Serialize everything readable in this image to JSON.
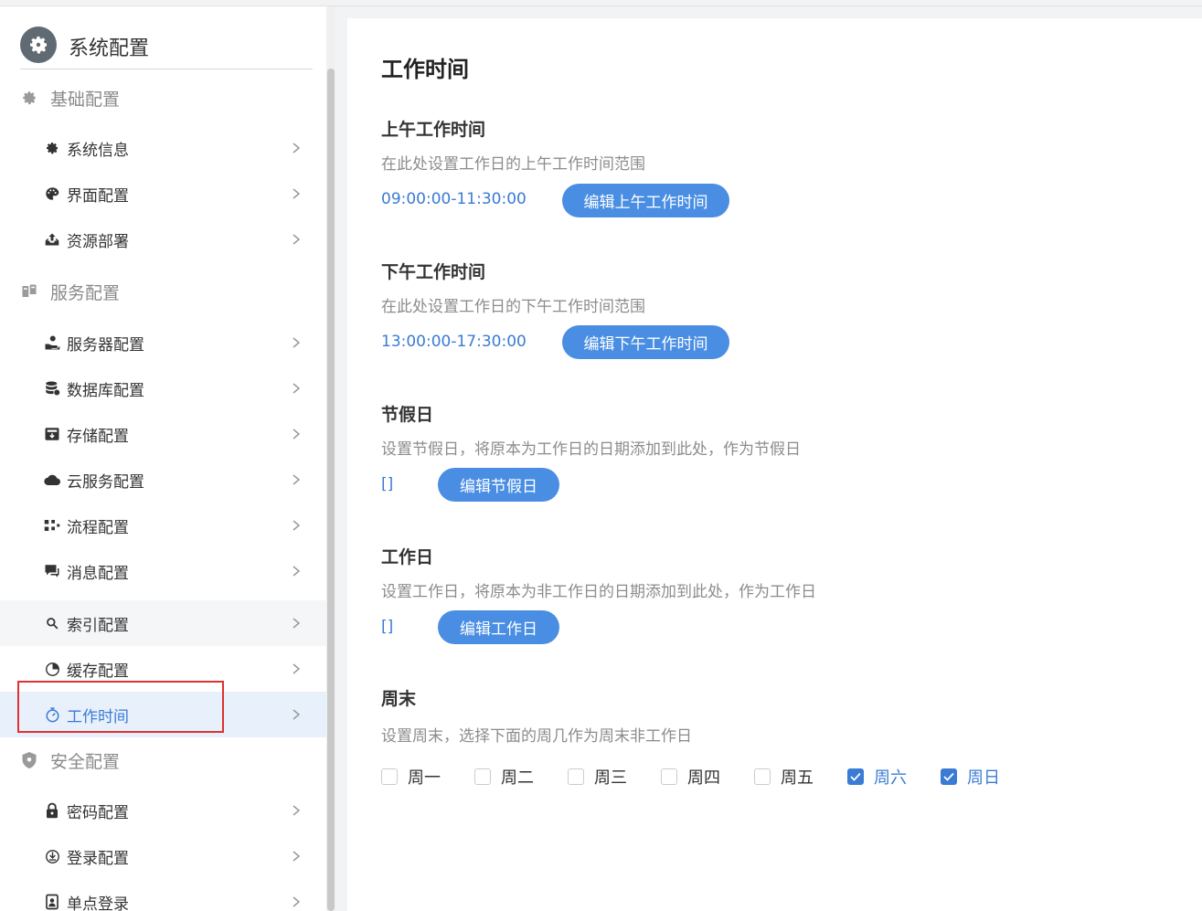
{
  "app": {
    "title": "系统配置"
  },
  "sidebar": {
    "groups": [
      {
        "label": "基础配置",
        "icon": "gear-icon",
        "items": [
          {
            "label": "系统信息",
            "icon": "gear-icon"
          },
          {
            "label": "界面配置",
            "icon": "palette-icon"
          },
          {
            "label": "资源部署",
            "icon": "upload-tray-icon"
          }
        ]
      },
      {
        "label": "服务配置",
        "icon": "server-rack-icon",
        "items": [
          {
            "label": "服务器配置",
            "icon": "server-hand-icon"
          },
          {
            "label": "数据库配置",
            "icon": "database-icon"
          },
          {
            "label": "存储配置",
            "icon": "archive-icon"
          },
          {
            "label": "云服务配置",
            "icon": "cloud-icon"
          },
          {
            "label": "流程配置",
            "icon": "flow-icon"
          },
          {
            "label": "消息配置",
            "icon": "chat-icon"
          },
          {
            "label": "索引配置",
            "icon": "search-icon"
          },
          {
            "label": "缓存配置",
            "icon": "pie-icon"
          },
          {
            "label": "工作时间",
            "icon": "stopwatch-icon",
            "active": true
          }
        ]
      },
      {
        "label": "安全配置",
        "icon": "shield-icon",
        "items": [
          {
            "label": "密码配置",
            "icon": "lock-icon"
          },
          {
            "label": "登录配置",
            "icon": "login-icon"
          },
          {
            "label": "单点登录",
            "icon": "sso-icon"
          }
        ]
      }
    ]
  },
  "main": {
    "title": "工作时间",
    "sections": [
      {
        "title": "上午工作时间",
        "desc": "在此处设置工作日的上午工作时间范围",
        "value": "09:00:00-11:30:00",
        "button": "编辑上午工作时间"
      },
      {
        "title": "下午工作时间",
        "desc": "在此处设置工作日的下午工作时间范围",
        "value": "13:00:00-17:30:00",
        "button": "编辑下午工作时间"
      },
      {
        "title": "节假日",
        "desc": "设置节假日，将原本为工作日的日期添加到此处，作为节假日",
        "value": "[]",
        "button": "编辑节假日"
      },
      {
        "title": "工作日",
        "desc": "设置工作日，将原本为非工作日的日期添加到此处，作为工作日",
        "value": "[]",
        "button": "编辑工作日"
      }
    ],
    "weekend": {
      "title": "周末",
      "desc": "设置周末，选择下面的周几作为周末非工作日",
      "days": [
        {
          "label": "周一",
          "checked": false
        },
        {
          "label": "周二",
          "checked": false
        },
        {
          "label": "周三",
          "checked": false
        },
        {
          "label": "周四",
          "checked": false
        },
        {
          "label": "周五",
          "checked": false
        },
        {
          "label": "周六",
          "checked": true
        },
        {
          "label": "周日",
          "checked": true
        }
      ]
    }
  },
  "colors": {
    "accent": "#3a7bd5",
    "button": "#4a8ee3",
    "highlight_box": "#e03131"
  }
}
